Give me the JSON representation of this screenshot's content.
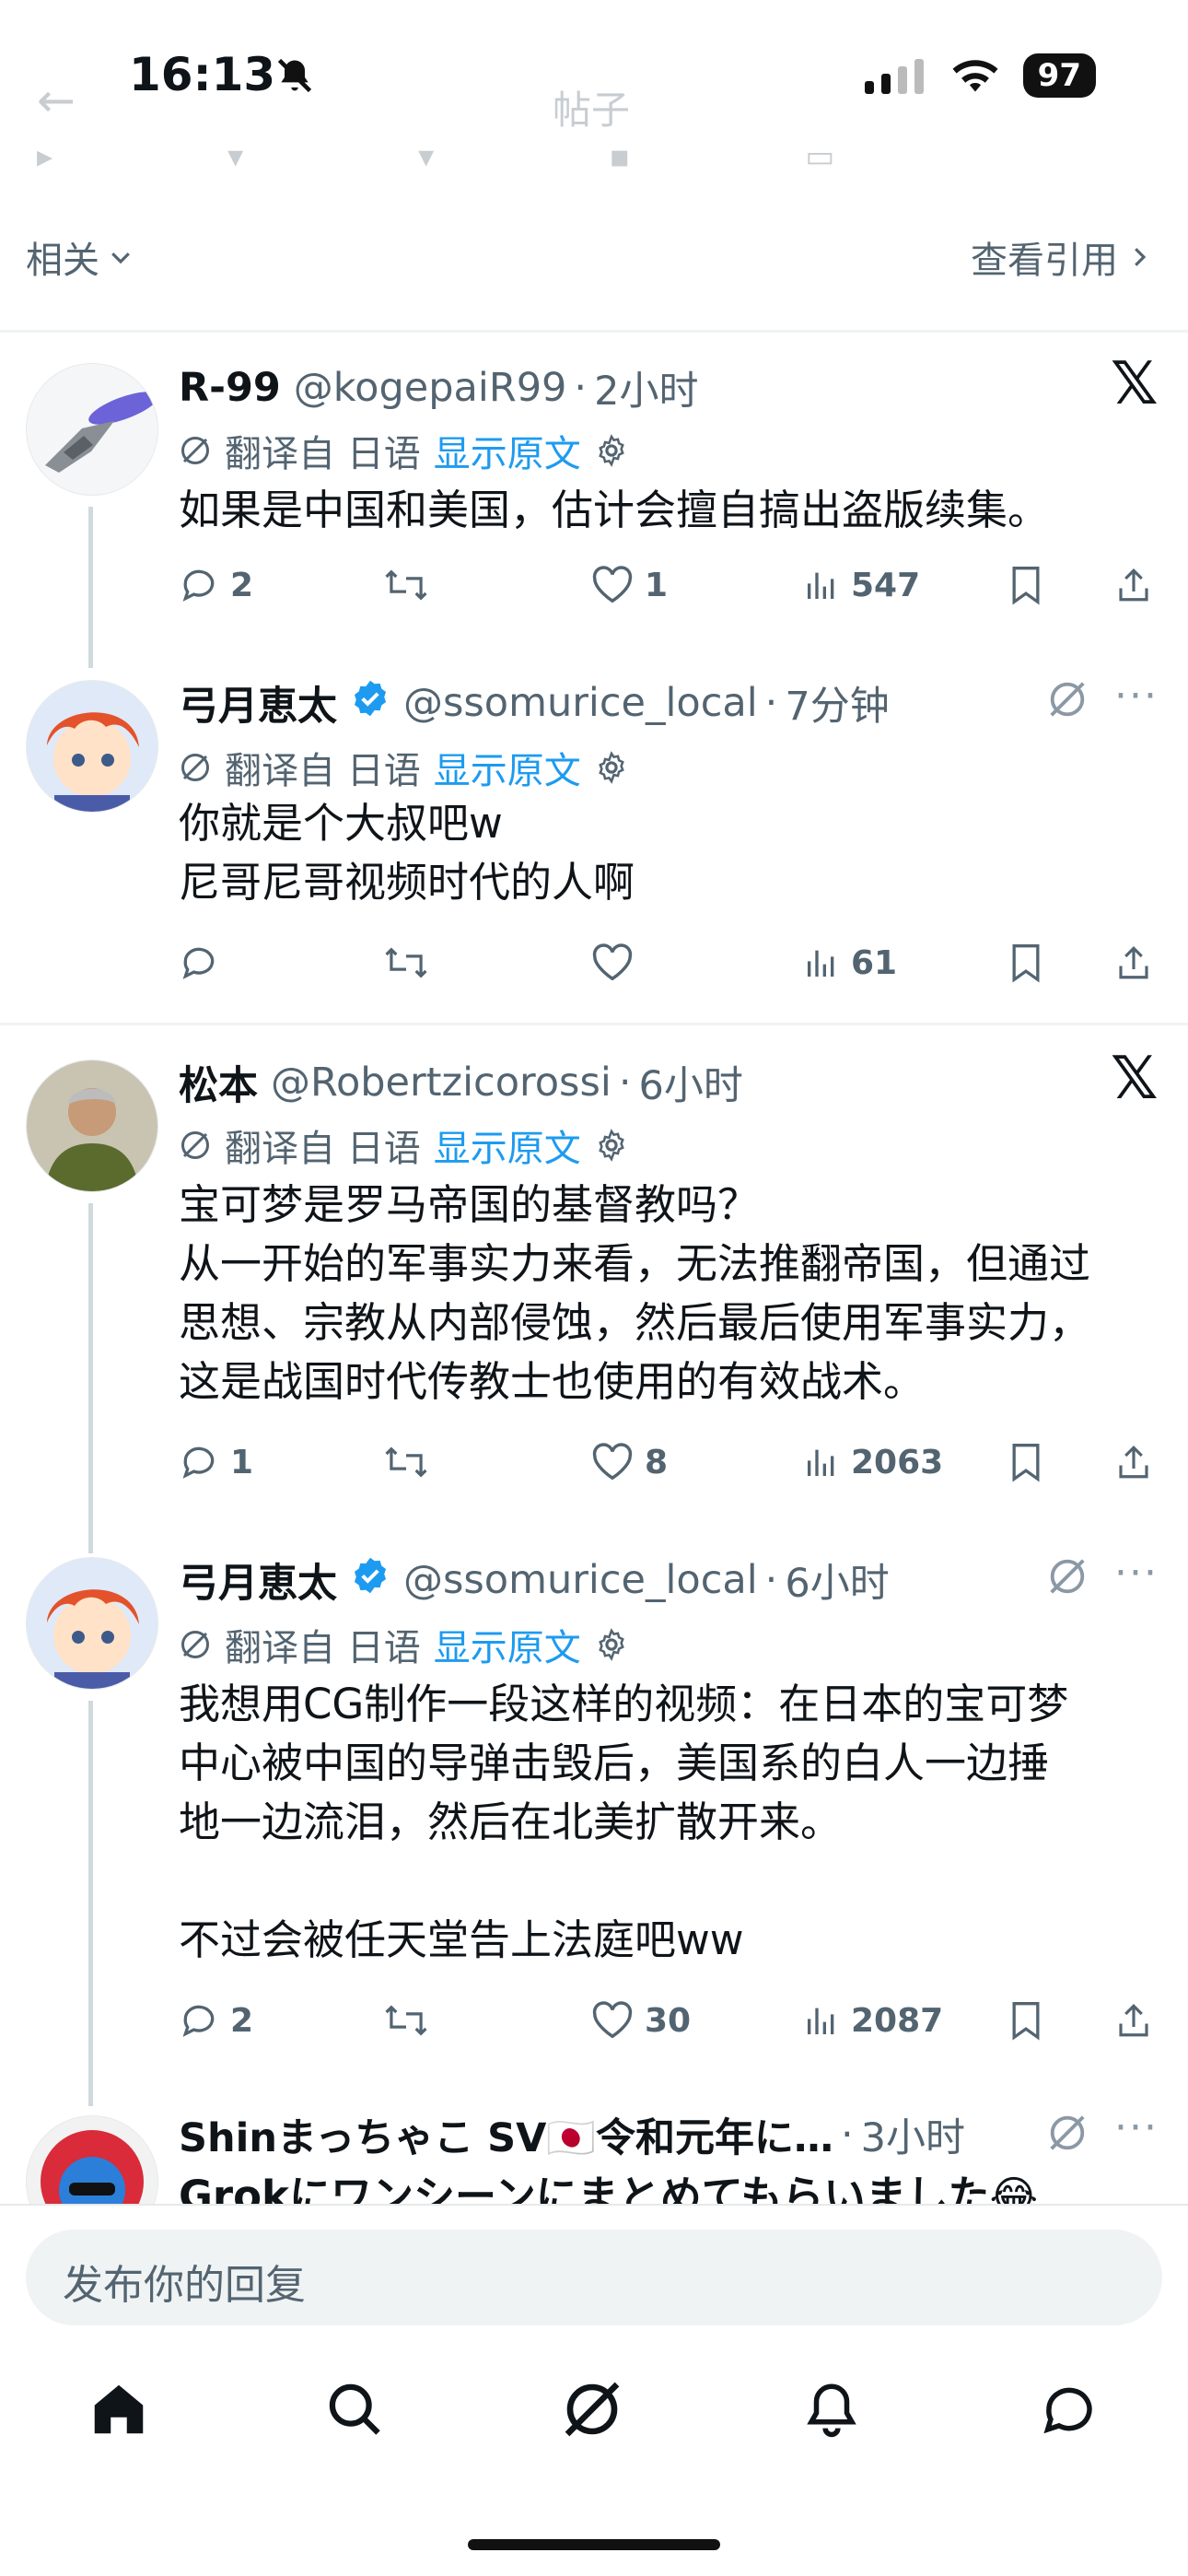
{
  "status": {
    "time": "16:13",
    "battery": "97"
  },
  "header": {
    "faded_title": "帖子"
  },
  "related": {
    "label": "相关",
    "quotes_link": "查看引用"
  },
  "translation": {
    "label": "翻译自 日语",
    "show_original": "显示原文"
  },
  "tweets": [
    {
      "name": "R-99",
      "handle": "@kogepaiR99",
      "time": "2小时",
      "text": "如果是中国和美国，估计会擅自搞出盗版续集。",
      "reply": "2",
      "retweet": "",
      "like": "1",
      "views": "547"
    },
    {
      "name": "弓月恵太",
      "handle": "@ssomurice_local",
      "time": "7分钟",
      "text": "你就是个大叔吧w\n尼哥尼哥视频时代的人啊",
      "reply": "",
      "retweet": "",
      "like": "",
      "views": "61"
    },
    {
      "name": "松本",
      "handle": "@Robertzicorossi",
      "time": "6小时",
      "text": "宝可梦是罗马帝国的基督教吗？\n从一开始的军事实力来看，无法推翻帝国，但通过\n思想、宗教从内部侵蚀，然后最后使用军事实力，\n这是战国时代传教士也使用的有效战术。",
      "reply": "1",
      "retweet": "",
      "like": "8",
      "views": "2063"
    },
    {
      "name": "弓月恵太",
      "handle": "@ssomurice_local",
      "time": "6小时",
      "text": "我想用CG制作一段这样的视频：在日本的宝可梦\n中心被中国的导弹击毁后，美国系的白人一边捶\n地一边流泪，然后在北美扩散开来。\n\n不过会被任天堂告上法庭吧ww",
      "reply": "2",
      "retweet": "",
      "like": "30",
      "views": "2087"
    },
    {
      "name": "Shinまっちゃこ SV🇯🇵令和元年に…",
      "time": "3小时",
      "text": "Grokにワンシーンにまとめてもらいました😂"
    }
  ],
  "reply_placeholder": "发布你的回复",
  "colors": {
    "accent": "#1d9bf0",
    "text": "#0f1419",
    "muted": "#536471"
  }
}
